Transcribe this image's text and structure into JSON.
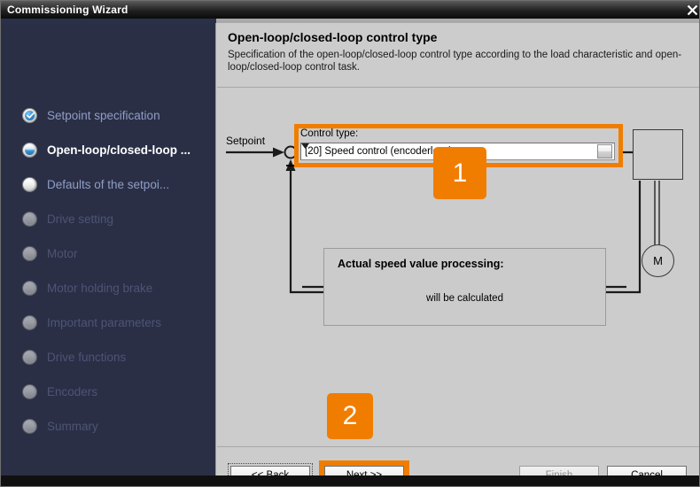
{
  "window": {
    "title": "Commissioning Wizard",
    "close_icon": "close-icon"
  },
  "sidebar": {
    "steps": [
      {
        "label": "Setpoint specification",
        "state": "done"
      },
      {
        "label": "Open-loop/closed-loop ...",
        "state": "current"
      },
      {
        "label": "Defaults of the setpoi...",
        "state": "open"
      },
      {
        "label": "Drive setting",
        "state": "disabled"
      },
      {
        "label": "Motor",
        "state": "disabled"
      },
      {
        "label": "Motor holding brake",
        "state": "disabled"
      },
      {
        "label": "Important parameters",
        "state": "disabled"
      },
      {
        "label": "Drive functions",
        "state": "disabled"
      },
      {
        "label": "Encoders",
        "state": "disabled"
      },
      {
        "label": "Summary",
        "state": "disabled"
      }
    ]
  },
  "main": {
    "title": "Open-loop/closed-loop control type",
    "description": "Specification of the open-loop/closed-loop control type according to the load characteristic and open-loop/closed-loop control task."
  },
  "diagram": {
    "setpoint_label": "Setpoint",
    "minus_sign": "−",
    "control_type_caption": "Control type:",
    "control_type_value": "[20] Speed control (encoderless)",
    "control_type_arrow_icon": "chevron-down-icon",
    "inverter_icon": "transistor-inverter-icon",
    "motor_letter": "M",
    "speed_box_title": "Actual speed value processing:",
    "speed_box_text": "will be calculated"
  },
  "annotations": {
    "badge_1": "1",
    "badge_2": "2"
  },
  "footer": {
    "back": "<< Back",
    "next": "Next >>",
    "finish": "Finish",
    "cancel": "Cancel"
  },
  "colors": {
    "accent_orange": "#f07d00",
    "sidebar_navy": "#2a2f46",
    "panel_grey": "#cccccc",
    "step_done_blue": "#2e86c8"
  }
}
